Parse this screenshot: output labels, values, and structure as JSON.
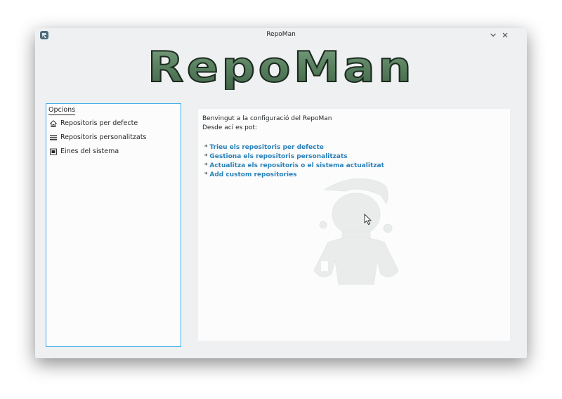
{
  "window": {
    "title": "RepoMan",
    "minimize_glyph": "⌵",
    "close_glyph": "✕",
    "app_icon": "repoman-app-icon"
  },
  "logo": {
    "text": "RepoMan",
    "fill_color": "#5b7f64",
    "stroke_color": "#1c2a20"
  },
  "sidebar": {
    "title": "Opcions",
    "items": [
      {
        "label": "Repositoris per defecte",
        "icon": "home-icon"
      },
      {
        "label": "Repositoris personalitzats",
        "icon": "list-icon"
      },
      {
        "label": "Eines del sistema",
        "icon": "system-tools-icon"
      }
    ],
    "border_color": "#3daee9"
  },
  "content": {
    "welcome": "Benvingut a la configuració del RepoMan",
    "intro": "Desde ací es pot:",
    "bullet": "*",
    "links": [
      "Trieu els repositoris per defecte",
      "Gestiona els repositoris personalitzats",
      "Actualitza els repositoris o el sistema actualitzat",
      "Add custom repositories"
    ],
    "link_color": "#2980b9"
  }
}
